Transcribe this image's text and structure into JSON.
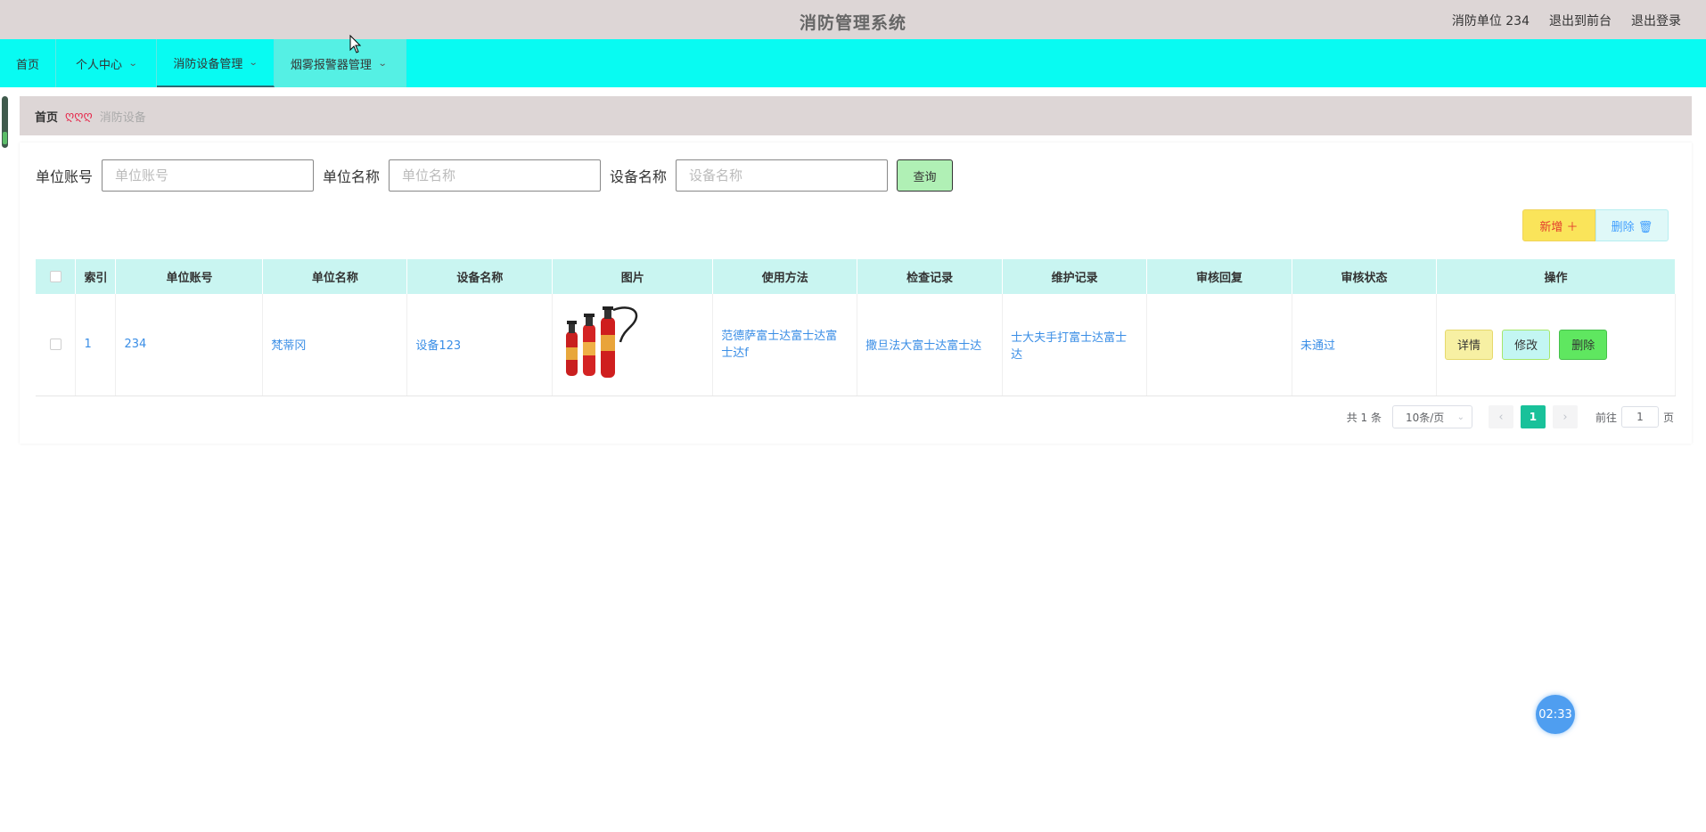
{
  "header": {
    "title": "消防管理系统",
    "user": "消防单位 234",
    "back_to_front": "退出到前台",
    "logout": "退出登录"
  },
  "nav": {
    "items": [
      {
        "label": "首页"
      },
      {
        "label": "个人中心"
      },
      {
        "label": "消防设备管理"
      },
      {
        "label": "烟雾报警器管理"
      }
    ]
  },
  "breadcrumb": {
    "home": "首页",
    "separator": "ღღღ",
    "current": "消防设备"
  },
  "search": {
    "fields": [
      {
        "label": "单位账号",
        "placeholder": "单位账号"
      },
      {
        "label": "单位名称",
        "placeholder": "单位名称"
      },
      {
        "label": "设备名称",
        "placeholder": "设备名称"
      }
    ],
    "query_label": "查询"
  },
  "actions": {
    "add_label": "新增 ＋",
    "delete_label": "删除 🗑"
  },
  "table": {
    "columns": [
      "索引",
      "单位账号",
      "单位名称",
      "设备名称",
      "图片",
      "使用方法",
      "检查记录",
      "维护记录",
      "审核回复",
      "审核状态",
      "操作"
    ],
    "rows": [
      {
        "index": "1",
        "account": "234",
        "unit_name": "梵蒂冈",
        "device_name": "设备123",
        "usage": "范德萨富士达富士达富士达f",
        "check_record": "撒旦法大富士达富士达",
        "maintain_record": "士大夫手打富士达富士达",
        "review_reply": "",
        "review_status": "未通过",
        "ops": {
          "detail": "详情",
          "edit": "修改",
          "delete": "删除"
        }
      }
    ]
  },
  "pagination": {
    "total_text": "共 1 条",
    "page_size": "10条/页",
    "current_page": "1",
    "goto_prefix": "前往",
    "goto_value": "1",
    "goto_suffix": "页"
  },
  "timer": "02:33",
  "colors": {
    "header_bg": "#ddd6d6",
    "nav_bg": "#08fbf2",
    "table_header_bg": "#c9f5f1",
    "link_blue": "#3a8ee6",
    "page_active": "#19c19a"
  }
}
